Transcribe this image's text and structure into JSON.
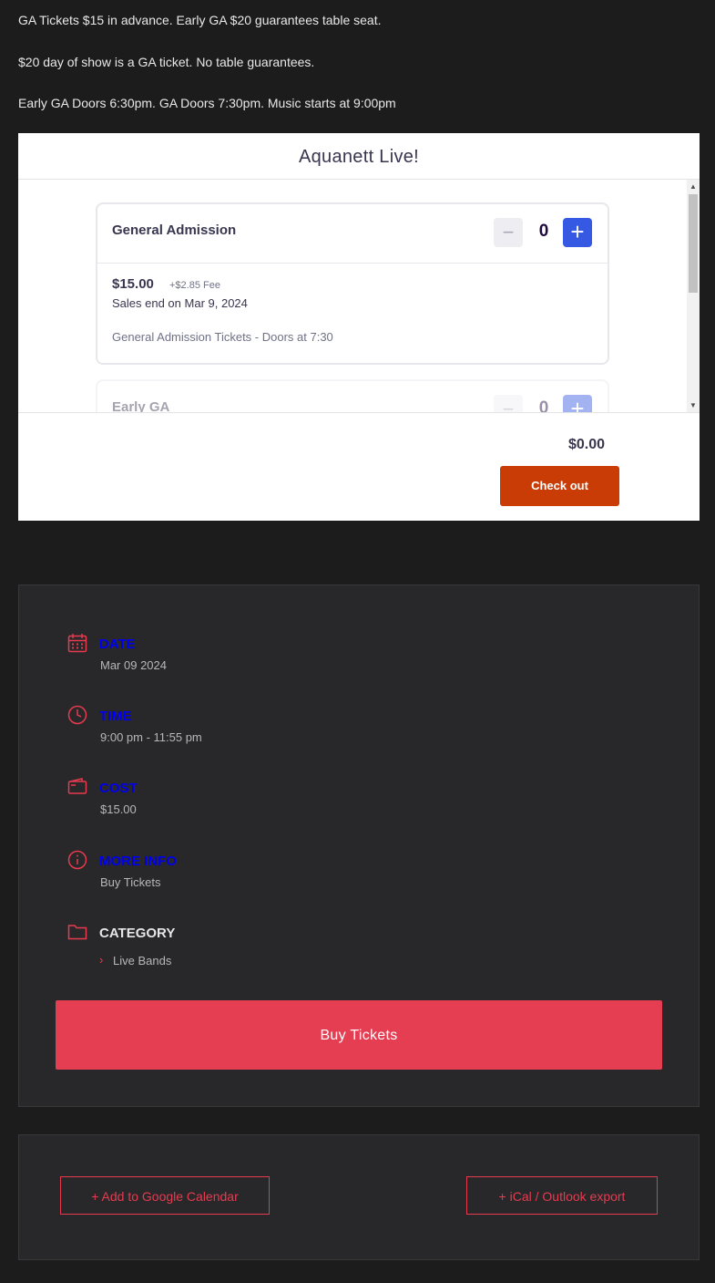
{
  "intro": {
    "line1": "GA Tickets $15 in advance. Early GA $20 guarantees table seat.",
    "line2": "$20 day of show is a GA ticket. No table guarantees.",
    "line3": "Early GA Doors 6:30pm. GA Doors 7:30pm. Music starts at 9:00pm"
  },
  "widget": {
    "title": "Aquanett Live!",
    "tickets": [
      {
        "name": "General Admission",
        "quantity": "0",
        "minus": "−",
        "plus": "+",
        "price": "$15.00",
        "fee": "+$2.85 Fee",
        "sales_end": "Sales end on Mar 9, 2024",
        "description": "General Admission Tickets - Doors at 7:30"
      },
      {
        "name": "Early GA",
        "quantity": "0",
        "minus": "−",
        "plus": "+"
      }
    ],
    "total": "$0.00",
    "checkout_label": "Check out"
  },
  "details": {
    "date": {
      "label": "DATE",
      "value": "Mar 09 2024"
    },
    "time": {
      "label": "TIME",
      "value": "9:00 pm - 11:55 pm"
    },
    "cost": {
      "label": "COST",
      "value": "$15.00"
    },
    "more_info": {
      "label": "MORE INFO",
      "value": "Buy Tickets"
    },
    "category": {
      "label": "CATEGORY",
      "items": [
        "Live Bands"
      ]
    },
    "buy_button": "Buy Tickets"
  },
  "exports": {
    "google": "+ Add to Google Calendar",
    "ical": "+ iCal / Outlook export"
  },
  "colors": {
    "accent": "#e53d52",
    "checkout": "#c93c06",
    "stepper_plus": "#3659e3",
    "label_link": "#0000ee",
    "background": "#1c1c1d",
    "panel": "#28282a"
  }
}
